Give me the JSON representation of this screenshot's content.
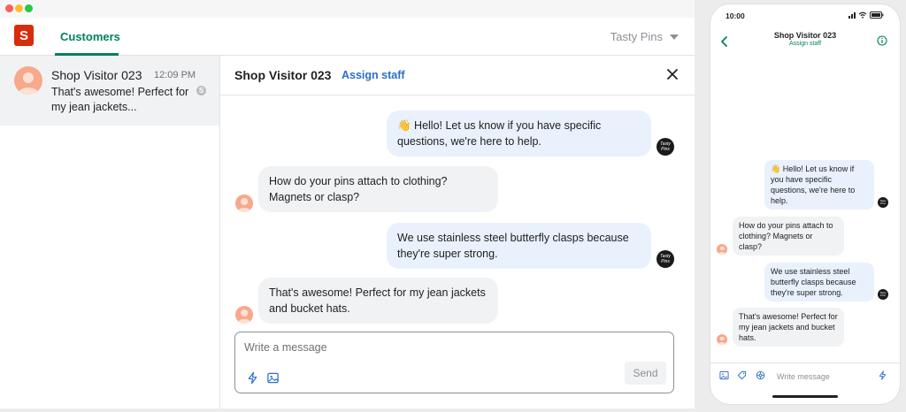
{
  "desktop": {
    "logo_letter": "S",
    "nav": {
      "customers_tab": "Customers",
      "store_name": "Tasty Pins"
    },
    "conversation_list": [
      {
        "name": "Shop Visitor 023",
        "time": "12:09 PM",
        "preview": "That's awesome! Perfect for my jean jackets...",
        "channel_badge": "S"
      }
    ],
    "chat": {
      "title": "Shop Visitor 023",
      "assign_staff": "Assign staff",
      "messages": [
        {
          "from": "merchant",
          "text": "👋 Hello! Let us know if you have specific questions, we're here to help."
        },
        {
          "from": "customer",
          "text": "How do your pins attach to clothing? Magnets or clasp?"
        },
        {
          "from": "merchant",
          "text": "We use stainless steel butterfly clasps because they're super strong."
        },
        {
          "from": "customer",
          "text": "That's awesome! Perfect for my jean jackets and bucket hats."
        }
      ],
      "merchant_avatar_text": "Tasty Pins",
      "composer_placeholder": "Write a message",
      "send_label": "Send"
    }
  },
  "phone": {
    "time": "10:00",
    "title": "Shop Visitor 023",
    "assign_staff": "Assign staff",
    "messages": [
      {
        "from": "merchant",
        "text": "👋 Hello! Let us know if you have specific questions, we're here to help."
      },
      {
        "from": "customer",
        "text": "How do your pins attach to clothing? Magnets or clasp?"
      },
      {
        "from": "merchant",
        "text": "We use stainless steel butterfly clasps because they're super strong."
      },
      {
        "from": "customer",
        "text": "That's awesome! Perfect for my jean jackets and bucket hats."
      }
    ],
    "merchant_avatar_text": "Tasty Pins",
    "composer_placeholder": "Write message"
  },
  "colors": {
    "accent_green": "#008060",
    "link_blue": "#2c6ecb",
    "outgoing_bubble": "#e8f1fc",
    "incoming_bubble": "#f1f2f3"
  }
}
